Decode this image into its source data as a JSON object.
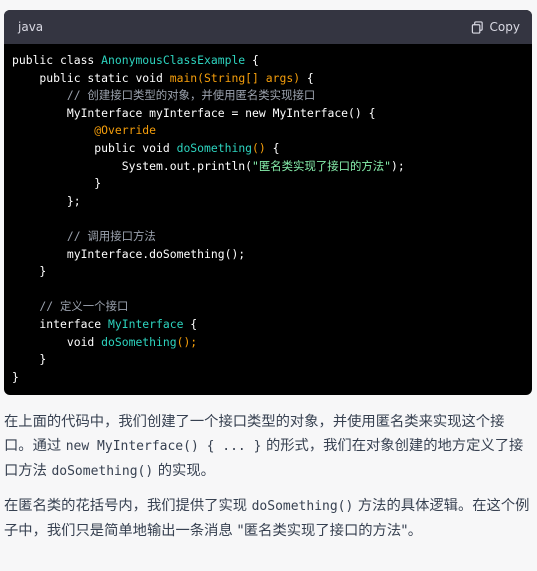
{
  "code_block": {
    "language": "java",
    "copy_label": "Copy",
    "lines": [
      [
        {
          "t": "public class ",
          "c": "plain"
        },
        {
          "t": "AnonymousClassExample",
          "c": "cls"
        },
        {
          "t": " {",
          "c": "plain"
        }
      ],
      [
        {
          "t": "    public static void ",
          "c": "plain"
        },
        {
          "t": "main",
          "c": "fn"
        },
        {
          "t": "(",
          "c": "fn"
        },
        {
          "t": "String[] args",
          "c": "fn"
        },
        {
          "t": ")",
          "c": "fn"
        },
        {
          "t": " {",
          "c": "plain"
        }
      ],
      [
        {
          "t": "        // 创建接口类型的对象，并使用匿名类实现接口",
          "c": "cm"
        }
      ],
      [
        {
          "t": "        MyInterface myInterface = new MyInterface() {",
          "c": "plain"
        }
      ],
      [
        {
          "t": "            ",
          "c": "plain"
        },
        {
          "t": "@Override",
          "c": "ann"
        }
      ],
      [
        {
          "t": "            public void ",
          "c": "plain"
        },
        {
          "t": "doSomething",
          "c": "cls"
        },
        {
          "t": "()",
          "c": "fn"
        },
        {
          "t": " {",
          "c": "plain"
        }
      ],
      [
        {
          "t": "                System.out.println(",
          "c": "plain"
        },
        {
          "t": "\"匿名类实现了接口的方法\"",
          "c": "str"
        },
        {
          "t": ");",
          "c": "plain"
        }
      ],
      [
        {
          "t": "            }",
          "c": "plain"
        }
      ],
      [
        {
          "t": "        };",
          "c": "plain"
        }
      ],
      [
        {
          "t": "",
          "c": "plain"
        }
      ],
      [
        {
          "t": "        // 调用接口方法",
          "c": "cm"
        }
      ],
      [
        {
          "t": "        myInterface.doSomething();",
          "c": "plain"
        }
      ],
      [
        {
          "t": "    }",
          "c": "plain"
        }
      ],
      [
        {
          "t": "",
          "c": "plain"
        }
      ],
      [
        {
          "t": "    // 定义一个接口",
          "c": "cm"
        }
      ],
      [
        {
          "t": "    interface ",
          "c": "plain"
        },
        {
          "t": "MyInterface",
          "c": "cls"
        },
        {
          "t": " {",
          "c": "plain"
        }
      ],
      [
        {
          "t": "        void ",
          "c": "plain"
        },
        {
          "t": "doSomething",
          "c": "cls"
        },
        {
          "t": "();",
          "c": "fn"
        }
      ],
      [
        {
          "t": "    }",
          "c": "plain"
        }
      ],
      [
        {
          "t": "}",
          "c": "plain"
        }
      ]
    ]
  },
  "paragraph1": {
    "text_a": "在上面的代码中，我们创建了一个接口类型的对象，并使用匿名类来实现这个接口。通过 ",
    "code_a": "new MyInterface() { ... }",
    "text_b": " 的形式，我们在对象创建的地方定义了接口方法 ",
    "code_b": "doSomething()",
    "text_c": " 的实现。"
  },
  "paragraph2": {
    "text_a": "在匿名类的花括号内，我们提供了实现 ",
    "code_a": "doSomething()",
    "text_b": " 方法的具体逻辑。在这个例子中，我们只是简单地输出一条消息 \"匿名类实现了接口的方法\"。"
  }
}
